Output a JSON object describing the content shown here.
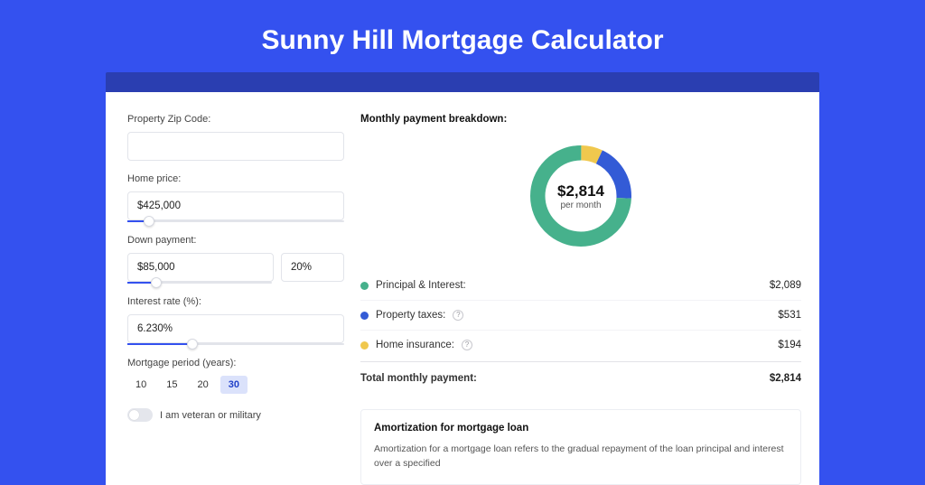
{
  "title": "Sunny Hill Mortgage Calculator",
  "form": {
    "zip_label": "Property Zip Code:",
    "zip_value": "",
    "home_price_label": "Home price:",
    "home_price_value": "$425,000",
    "home_price_slider_pct": 10,
    "down_payment_label": "Down payment:",
    "down_payment_value": "$85,000",
    "down_payment_pct_value": "20%",
    "down_payment_slider_pct": 20,
    "interest_label": "Interest rate (%):",
    "interest_value": "6.230%",
    "interest_slider_pct": 30,
    "period_label": "Mortgage period (years):",
    "period_options": [
      "10",
      "15",
      "20",
      "30"
    ],
    "period_selected": "30",
    "veteran_label": "I am veteran or military"
  },
  "breakdown": {
    "header": "Monthly payment breakdown:",
    "donut_amount": "$2,814",
    "donut_sub": "per month",
    "rows": [
      {
        "label": "Principal & Interest:",
        "value": "$2,089",
        "color": "#46b18c",
        "info": false,
        "pct": 74.2
      },
      {
        "label": "Property taxes:",
        "value": "$531",
        "color": "#335bd6",
        "info": true,
        "pct": 18.9
      },
      {
        "label": "Home insurance:",
        "value": "$194",
        "color": "#f0c84e",
        "info": true,
        "pct": 6.9
      }
    ],
    "total_label": "Total monthly payment:",
    "total_value": "$2,814"
  },
  "amortization": {
    "title": "Amortization for mortgage loan",
    "body": "Amortization for a mortgage loan refers to the gradual repayment of the loan principal and interest over a specified"
  },
  "chart_data": {
    "type": "pie",
    "title": "Monthly payment breakdown",
    "series": [
      {
        "name": "Principal & Interest",
        "value": 2089,
        "color": "#46b18c"
      },
      {
        "name": "Property taxes",
        "value": 531,
        "color": "#335bd6"
      },
      {
        "name": "Home insurance",
        "value": 194,
        "color": "#f0c84e"
      }
    ],
    "total": 2814,
    "unit": "USD per month"
  }
}
